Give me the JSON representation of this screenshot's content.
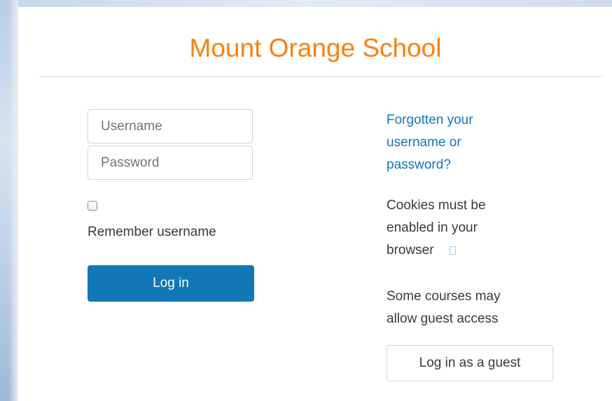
{
  "site": {
    "title": "Mount Orange School"
  },
  "login_form": {
    "username": {
      "value": "",
      "placeholder": "Username"
    },
    "password": {
      "value": "",
      "placeholder": "Password"
    },
    "remember_username": {
      "label": "Remember username",
      "checked": false
    },
    "login_label": "Log in"
  },
  "help": {
    "forgot_link": "Forgotten your username or password?",
    "cookies_text": "Cookies must be enabled in your browser",
    "guest_text": "Some courses may allow guest access",
    "guest_login_label": "Log in as a guest"
  },
  "colors": {
    "title": "#f98012",
    "primary": "#1177b5",
    "text": "#373a3c"
  },
  "icons": {
    "cookies_help": "help-icon"
  }
}
